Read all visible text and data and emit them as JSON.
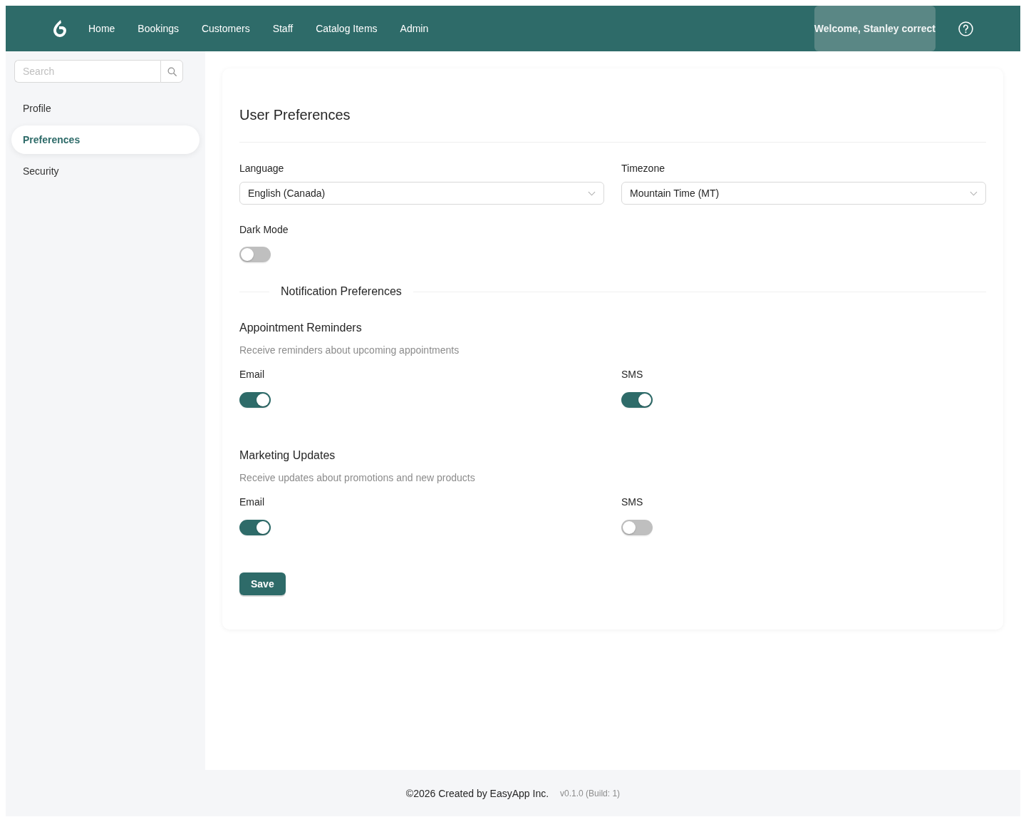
{
  "header": {
    "nav": [
      {
        "label": "Home"
      },
      {
        "label": "Bookings"
      },
      {
        "label": "Customers"
      },
      {
        "label": "Staff"
      },
      {
        "label": "Catalog Items"
      },
      {
        "label": "Admin"
      }
    ],
    "welcome": "Welcome, Stanley correct"
  },
  "sidebar": {
    "search": {
      "placeholder": "Search"
    },
    "items": [
      {
        "label": "Profile",
        "selected": false
      },
      {
        "label": "Preferences",
        "selected": true
      },
      {
        "label": "Security",
        "selected": false
      }
    ]
  },
  "card": {
    "title": "User Preferences",
    "selects": [
      {
        "label": "Language",
        "value": "English (Canada)"
      },
      {
        "label": "Timezone",
        "value": "Mountain Time (MT)"
      }
    ],
    "dark_mode": {
      "label": "Dark Mode",
      "on": false
    },
    "section_title": "Notification Preferences",
    "groups": [
      {
        "title": "Appointment Reminders",
        "description": "Receive reminders about upcoming appointments",
        "toggles": [
          {
            "label": "Email",
            "on": true
          },
          {
            "label": "SMS",
            "on": true
          }
        ]
      },
      {
        "title": "Marketing Updates",
        "description": "Receive updates about promotions and new products",
        "toggles": [
          {
            "label": "Email",
            "on": true
          },
          {
            "label": "SMS",
            "on": false
          }
        ]
      }
    ],
    "save": "Save"
  },
  "footer": {
    "copyright": "©2026 Created by EasyApp Inc.",
    "version": "v0.1.0 (Build: 1)"
  }
}
